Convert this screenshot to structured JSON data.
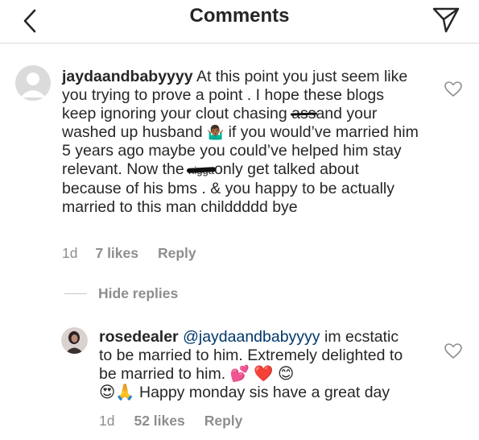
{
  "header": {
    "title": "Comments",
    "back_icon": "chevron-left-icon",
    "send_icon": "paper-plane-icon"
  },
  "comment": {
    "username": "jaydaandbabyyyy",
    "text_part1": "At this point you just seem like you trying to prove a point . I hope these blogs keep ignoring your clout chasing ",
    "censored_word_1": "ass",
    "text_part2": "and your washed up husband",
    "text_part3": " if you would’ve married him 5 years ago maybe you could’ve helped him stay relevant. Now the ",
    "censored_word_2": "nigga",
    "text_part4": "only get talked about because of his bms . & you happy to be actually married to this man childdddd bye",
    "emoji_1": "🤷🏾‍♂️",
    "time": "1d",
    "likes": "7 likes",
    "reply": "Reply",
    "heart_icon": "heart-outline-icon"
  },
  "hide_replies": {
    "label": "Hide replies"
  },
  "reply_comment": {
    "username": "rosedealer",
    "mention": "@jaydaandbabyyyy",
    "text_part1": " im ecstatic to be married to him. Extremely delighted to be married to him. ",
    "emojis_line1": [
      "💕",
      "❤️",
      "😊"
    ],
    "emojis_line2": [
      "😍",
      "🙏"
    ],
    "text_part2": " Happy monday sis have a great day",
    "time": "1d",
    "likes": "52 likes",
    "reply": "Reply",
    "heart_icon": "heart-outline-icon"
  },
  "colors": {
    "text": "#262626",
    "secondary": "#8e8e8e",
    "mention": "#00376b",
    "divider": "#dbdbdb"
  }
}
